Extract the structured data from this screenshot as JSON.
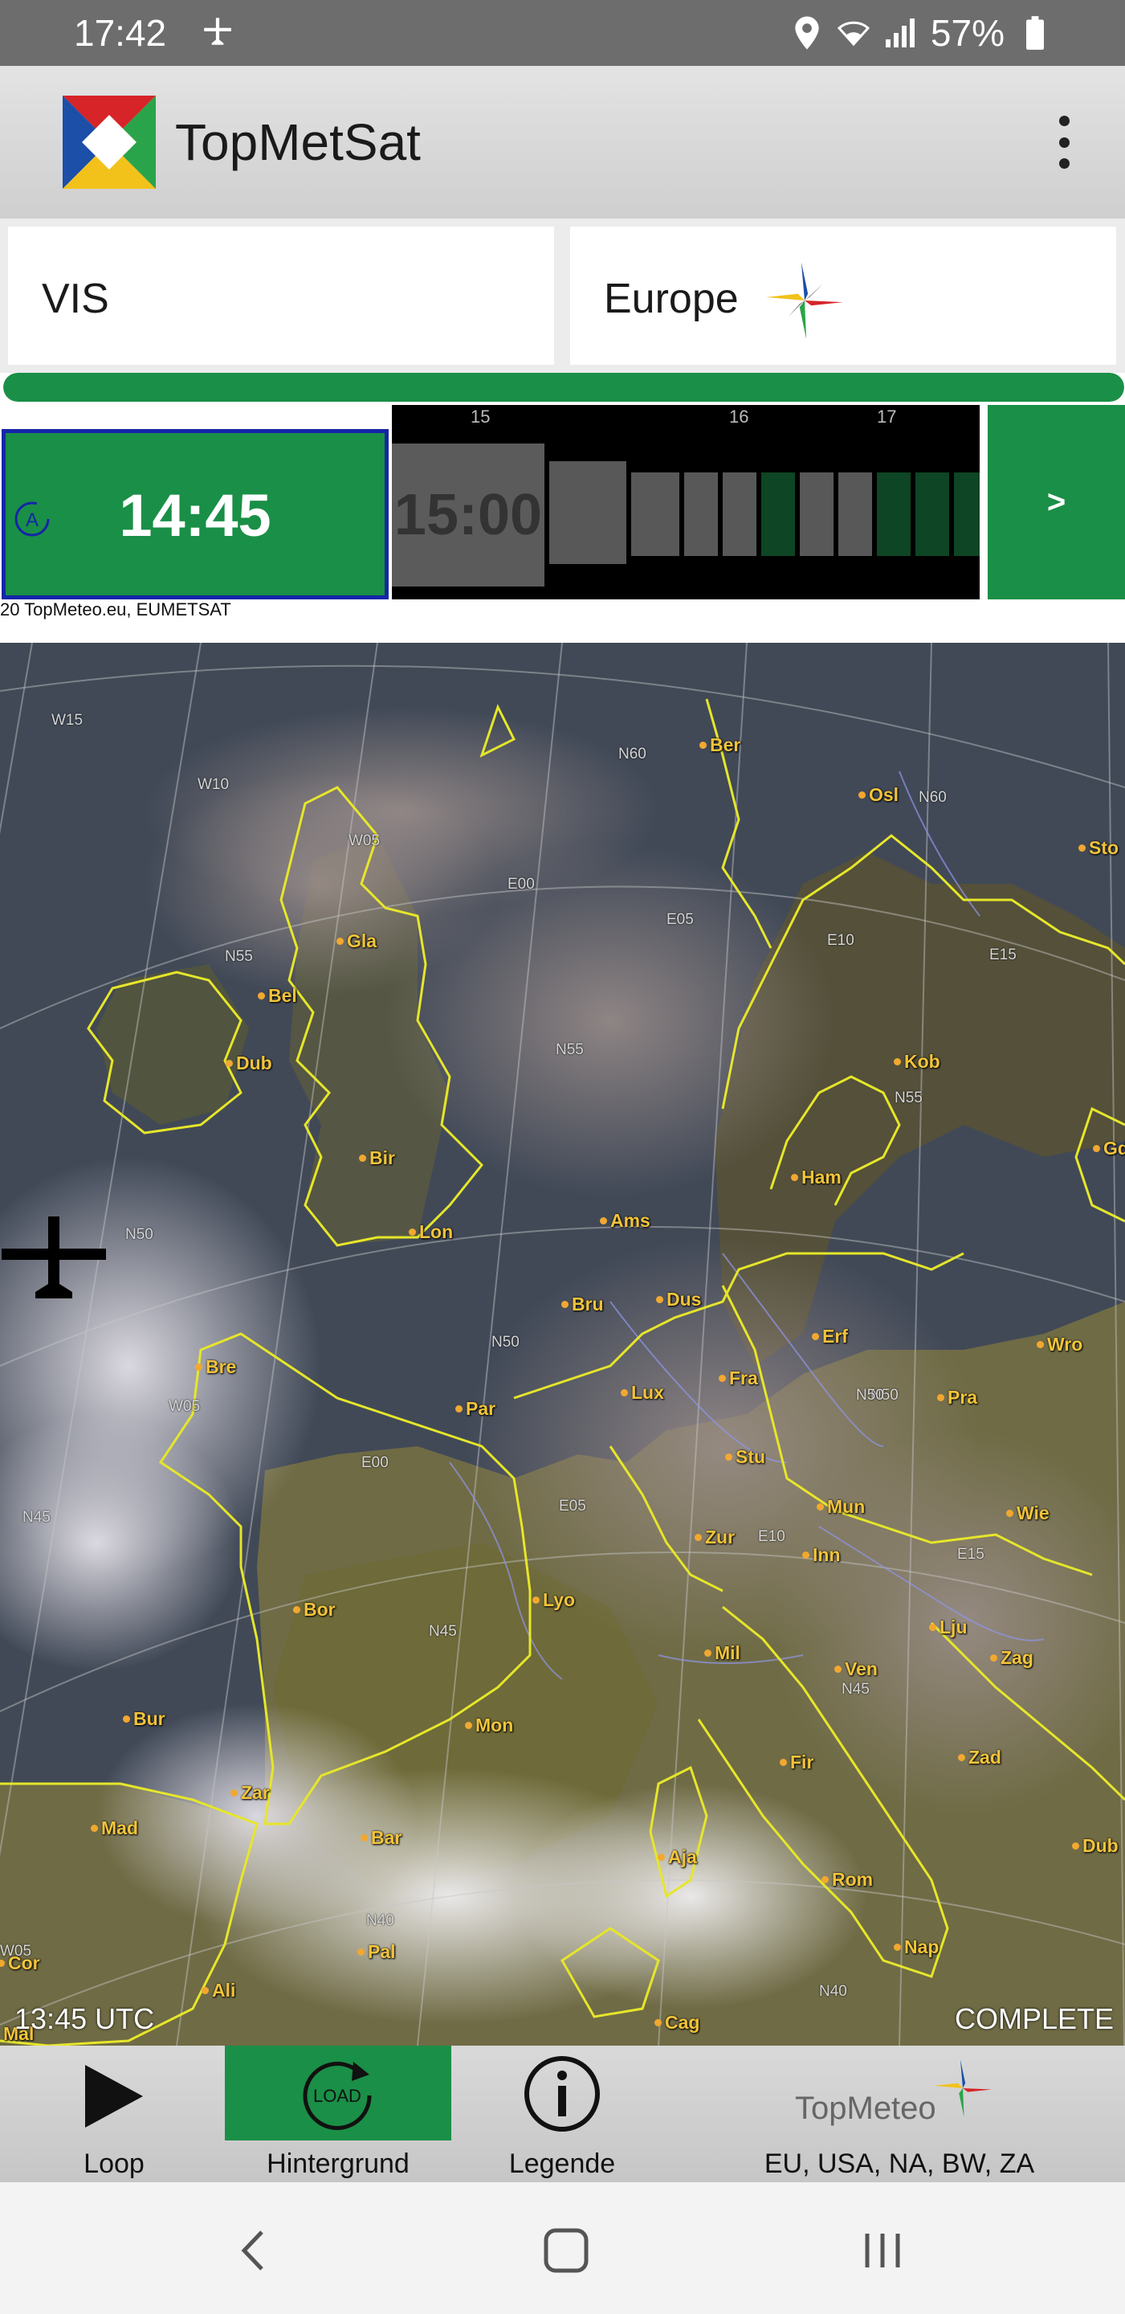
{
  "status_bar": {
    "time": "17:42",
    "battery": "57%",
    "icons": [
      "airplane-notification-icon",
      "location-icon",
      "wifi-icon",
      "signal-icon",
      "battery-icon"
    ]
  },
  "app_bar": {
    "title": "TopMetSat",
    "menu_icon": "more-vert-icon"
  },
  "selectors": {
    "channel": "VIS",
    "region": "Europe"
  },
  "progress": {
    "fraction": 1.0,
    "color": "#1a8f47"
  },
  "timeline": {
    "current_time": "14:45",
    "next_time": "15:00",
    "hour_marks": [
      "15",
      "16",
      "17"
    ],
    "next_button": ">"
  },
  "copyright": "20 TopMeteo.eu, EUMETSAT",
  "map": {
    "timestamp": "13:45 UTC",
    "status": "COMPLETE",
    "cities": [
      "Ber",
      "Osl",
      "Sto",
      "Gla",
      "Bel",
      "Dub",
      "Kob",
      "Ham",
      "Bir",
      "Lon",
      "Ams",
      "Dus",
      "Bru",
      "Erf",
      "Wro",
      "Bre",
      "Lux",
      "Fra",
      "Pra",
      "Par",
      "Stu",
      "Mun",
      "Wie",
      "Zur",
      "Inn",
      "Lyo",
      "Bor",
      "Lju",
      "Mil",
      "Ven",
      "Zag",
      "Bur",
      "Mon",
      "Fir",
      "Zad",
      "Zar",
      "Mad",
      "Bar",
      "Aja",
      "Rom",
      "Dub",
      "Pal",
      "Nap",
      "Cor",
      "Ali",
      "Cag",
      "Mal",
      "Gd"
    ],
    "grid_labels": [
      "W15",
      "W10",
      "W05",
      "E00",
      "E05",
      "E10",
      "E15",
      "N60",
      "N55",
      "N50",
      "N45",
      "N40",
      "N60",
      "N55",
      "N50",
      "N45",
      "W05",
      "E00",
      "E05",
      "E10",
      "E15",
      "N40",
      "N55",
      "N50",
      "N45",
      "W05",
      "N50"
    ]
  },
  "toolbar": {
    "loop": "Loop",
    "background": "Hintergrund",
    "background_icon_text": "LOAD",
    "legend": "Legende",
    "brand": "TopMeteo",
    "regions": "EU, USA, NA, BW, ZA"
  },
  "nav": {
    "back": "back-icon",
    "home": "home-icon",
    "recents": "recents-icon"
  },
  "colors": {
    "accent": "#1a8f47",
    "status_bar": "#6d6d6d",
    "selected_border": "#1525a8",
    "coastline": "#e6e62a",
    "city": "#f2c43a"
  }
}
